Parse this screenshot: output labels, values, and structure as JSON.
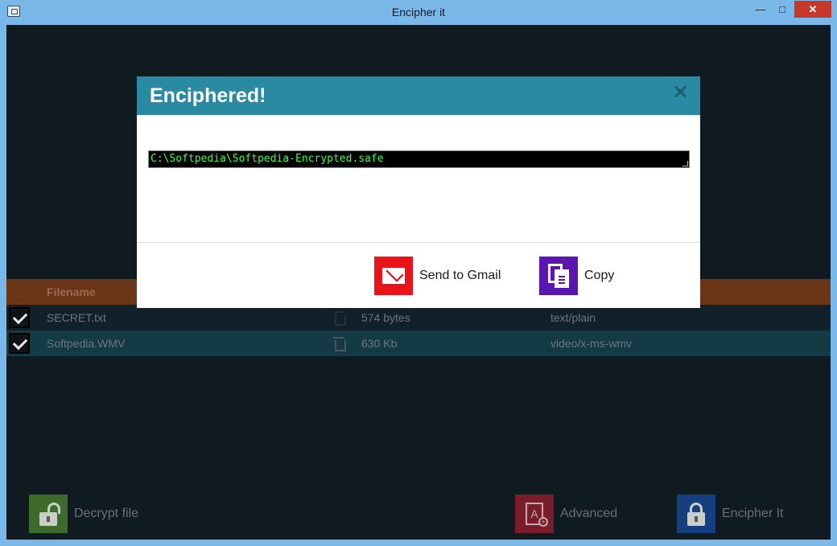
{
  "window": {
    "title": "Encipher it",
    "min_icon": "minimize-icon",
    "max_icon": "maximize-icon",
    "close_icon": "close-icon"
  },
  "table": {
    "header": {
      "filename": "Filename"
    },
    "rows": [
      {
        "name": "SECRET.txt",
        "size": "574 bytes",
        "type": "text/plain",
        "checked": true
      },
      {
        "name": "Softpedia.WMV",
        "size": "630 Kb",
        "type": "video/x-ms-wmv",
        "checked": true
      }
    ]
  },
  "actions": {
    "decrypt_label": "Decrypt file",
    "advanced_label": "Advanced",
    "encipher_label": "Encipher It"
  },
  "modal": {
    "title": "Enciphered!",
    "path": "C:\\Softpedia\\Softpedia-Encrypted.safe",
    "gmail_label": "Send to  Gmail",
    "copy_label": "Copy"
  },
  "colors": {
    "accent": "#2a8aa1",
    "table_header": "#6b3518",
    "gmail": "#e8141a",
    "copy": "#5a17b0",
    "path_text": "#3cff3c"
  }
}
